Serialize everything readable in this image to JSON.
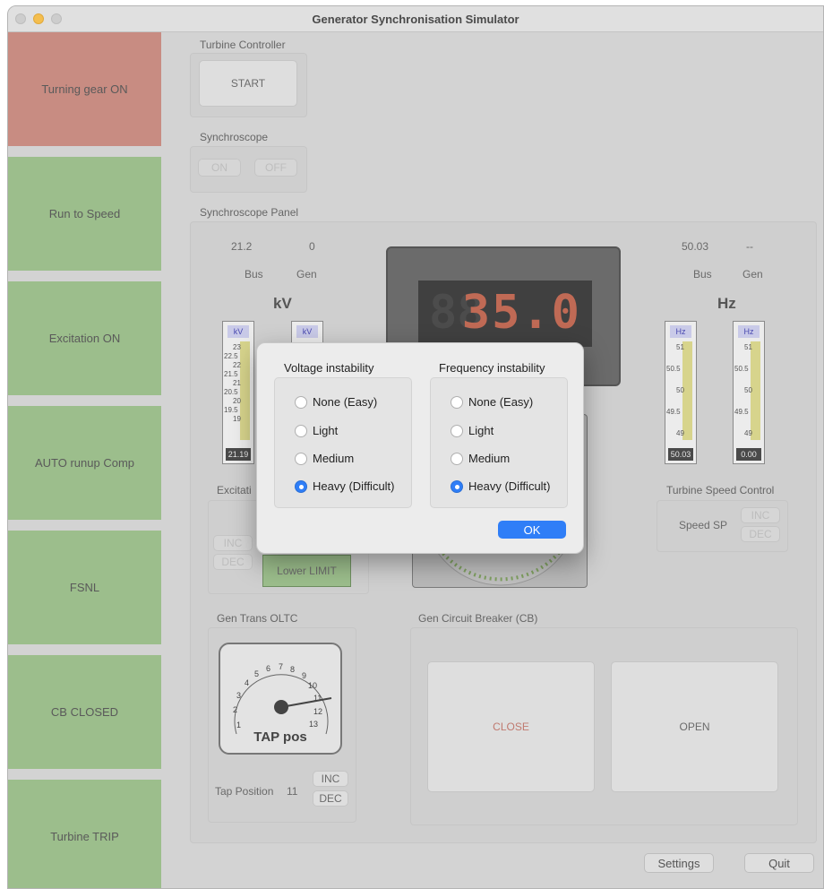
{
  "window": {
    "title": "Generator Synchronisation Simulator"
  },
  "sidebar": {
    "items": [
      {
        "label": "Turning gear ON",
        "color": "#c88c82"
      },
      {
        "label": "Run to Speed",
        "color": "#9cbe8c"
      },
      {
        "label": "Excitation ON",
        "color": "#9cbe8c"
      },
      {
        "label": "AUTO runup Comp",
        "color": "#9cbe8c"
      },
      {
        "label": "FSNL",
        "color": "#9cbe8c"
      },
      {
        "label": "CB CLOSED",
        "color": "#9cbe8c"
      },
      {
        "label": "Turbine TRIP",
        "color": "#9cbe8c"
      }
    ]
  },
  "turbine_controller": {
    "label": "Turbine Controller",
    "start": "START"
  },
  "synchroscope": {
    "label": "Synchroscope",
    "on": "ON",
    "off": "OFF"
  },
  "panel": {
    "label": "Synchroscope Panel",
    "kv": {
      "bus_value": "21.2",
      "gen_value": "0",
      "bus_label": "Bus",
      "gen_label": "Gen",
      "unit": "kV",
      "meter_unit": "kV",
      "ticks": [
        "23",
        "22.5",
        "22",
        "21.5",
        "21",
        "20.5",
        "20",
        "19.5",
        "19"
      ],
      "bus_reading": "21.19"
    },
    "hz": {
      "bus_value": "50.03",
      "gen_value": "--",
      "bus_label": "Bus",
      "gen_label": "Gen",
      "unit": "Hz",
      "meter_unit": "Hz",
      "ticks": [
        "51",
        "50.5",
        "50",
        "49.5",
        "49"
      ],
      "bus_reading": "50.03",
      "gen_reading": "0.00"
    },
    "lcd": {
      "value": "35.0",
      "ghost": "88"
    },
    "excitation": {
      "label": "Excitati",
      "inc": "INC",
      "dec": "DEC",
      "lower_limit": "Lower LIMIT"
    },
    "turbine_speed": {
      "label": "Turbine Speed Control",
      "sp": "Speed SP",
      "inc": "INC",
      "dec": "DEC"
    }
  },
  "oltc": {
    "label": "Gen Trans OLTC",
    "gauge_label": "TAP pos",
    "dial_numbers": [
      "1",
      "2",
      "3",
      "4",
      "5",
      "6",
      "7",
      "8",
      "9",
      "10",
      "11",
      "12",
      "13"
    ],
    "tap_label": "Tap Position",
    "tap_value": "11",
    "inc": "INC",
    "dec": "DEC"
  },
  "breaker": {
    "label": "Gen Circuit Breaker (CB)",
    "close": "CLOSE",
    "open": "OPEN"
  },
  "footer": {
    "settings": "Settings",
    "quit": "Quit"
  },
  "dialog": {
    "voltage": {
      "title": "Voltage instability",
      "options": [
        "None (Easy)",
        "Light",
        "Medium",
        "Heavy (Difficult)"
      ],
      "selected": "Heavy (Difficult)"
    },
    "frequency": {
      "title": "Frequency instability",
      "options": [
        "None (Easy)",
        "Light",
        "Medium",
        "Heavy (Difficult)"
      ],
      "selected": "Heavy (Difficult)"
    },
    "ok": "OK"
  }
}
